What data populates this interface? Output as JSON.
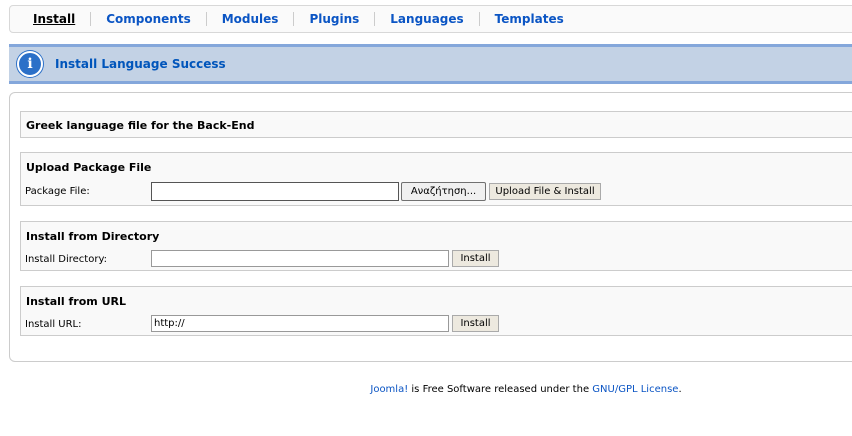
{
  "tabs": [
    {
      "label": "Install"
    },
    {
      "label": "Components"
    },
    {
      "label": "Modules"
    },
    {
      "label": "Plugins"
    },
    {
      "label": "Languages"
    },
    {
      "label": "Templates"
    }
  ],
  "message": {
    "text": "Install Language Success"
  },
  "result": {
    "description": "Greek language file for the Back-End"
  },
  "upload": {
    "title": "Upload Package File",
    "label": "Package File:",
    "value": "",
    "browse_label": "Αναζήτηση...",
    "button_label": "Upload File & Install"
  },
  "directory": {
    "title": "Install from Directory",
    "label": "Install Directory:",
    "value": "",
    "button_label": "Install"
  },
  "url": {
    "title": "Install from URL",
    "label": "Install URL:",
    "value": "http://",
    "button_label": "Install"
  },
  "footer": {
    "joomla": "Joomla!",
    "middle": " is Free Software released under the ",
    "license": "GNU/GPL License",
    "end": "."
  }
}
